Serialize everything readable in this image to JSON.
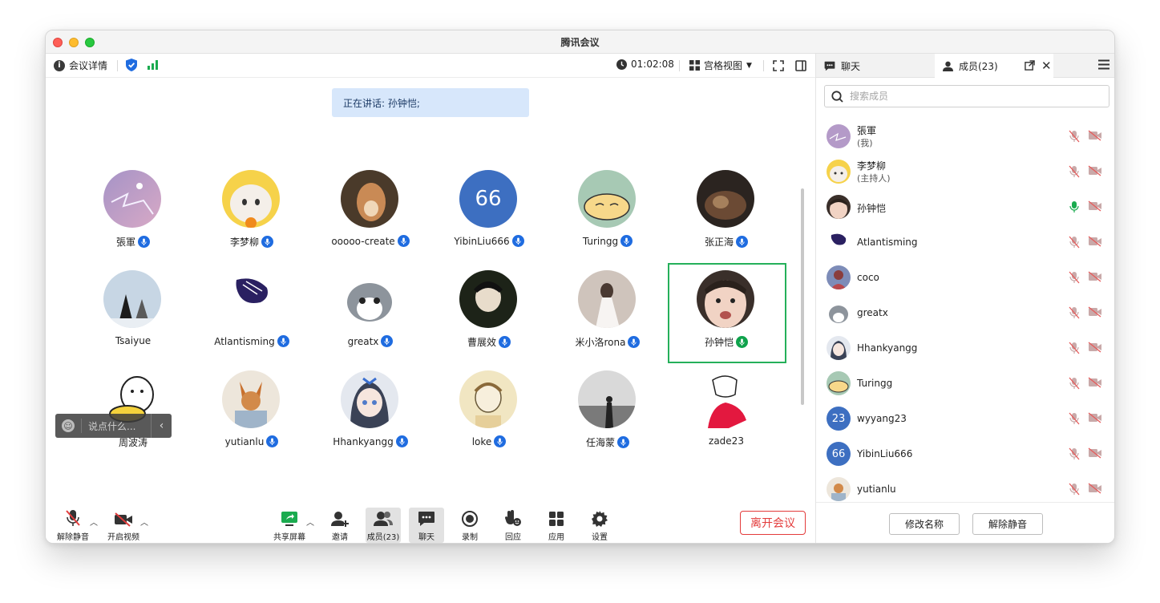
{
  "window": {
    "title": "腾讯会议"
  },
  "top_toolbar": {
    "details_label": "会议详情",
    "timer": "01:02:08",
    "view_label": "宫格视图"
  },
  "speaking_banner": "正在讲话: 孙钟恺;",
  "participants": [
    {
      "name": "張軍"
    },
    {
      "name": "李梦柳"
    },
    {
      "name": "ooooo-create"
    },
    {
      "name": "YibinLiu666",
      "avatar_text": "66"
    },
    {
      "name": "Turingg"
    },
    {
      "name": "张正海"
    },
    {
      "name": "Tsaiyue"
    },
    {
      "name": "Atlantisming"
    },
    {
      "name": "greatx"
    },
    {
      "name": "曹展效"
    },
    {
      "name": "米小洛rona"
    },
    {
      "name": "孙钟恺"
    },
    {
      "name": "周波涛"
    },
    {
      "name": "yutianlu"
    },
    {
      "name": "Hhankyangg"
    },
    {
      "name": "loke"
    },
    {
      "name": "任海蒙"
    },
    {
      "name": "zade23"
    }
  ],
  "chat_float": {
    "placeholder": "说点什么..."
  },
  "bottom_bar": {
    "unmute": "解除静音",
    "start_video": "开启视频",
    "share_screen": "共享屏幕",
    "invite": "邀请",
    "members": "成员(23)",
    "chat": "聊天",
    "record": "录制",
    "reactions": "回应",
    "apps": "应用",
    "settings": "设置",
    "leave": "离开会议"
  },
  "sidebar": {
    "chat_tab": "聊天",
    "members_tab": "成员(23)",
    "search_placeholder": "搜索成员",
    "members": [
      {
        "name": "張軍",
        "role": "(我)",
        "mic": "muted"
      },
      {
        "name": "李梦柳",
        "role": "(主持人)",
        "mic": "muted"
      },
      {
        "name": "孙钟恺",
        "mic": "active"
      },
      {
        "name": "Atlantisming",
        "mic": "muted"
      },
      {
        "name": "coco",
        "mic": "muted"
      },
      {
        "name": "greatx",
        "mic": "muted"
      },
      {
        "name": "Hhankyangg",
        "mic": "muted"
      },
      {
        "name": "Turingg",
        "mic": "muted"
      },
      {
        "name": "wyyang23",
        "avatar_text": "23",
        "mic": "muted"
      },
      {
        "name": "YibinLiu666",
        "avatar_text": "66",
        "mic": "muted"
      },
      {
        "name": "yutianlu",
        "mic": "muted"
      }
    ],
    "rename_button": "修改名称",
    "unmute_button": "解除静音"
  },
  "colors": {
    "accent": "#1f6ce0",
    "active_speaker": "#25b05a",
    "leave": "#e33b3b"
  }
}
